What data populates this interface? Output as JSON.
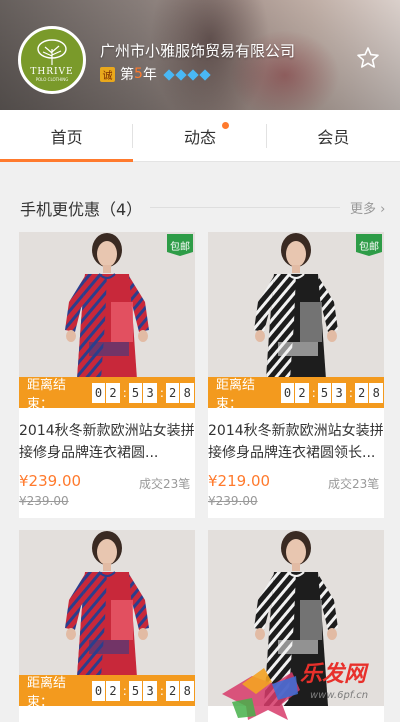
{
  "shop": {
    "logo_text": "THRIVE",
    "logo_sub": "POLO CLOTHING",
    "name": "广州市小雅服饰贸易有限公司",
    "cert_badge": "诚",
    "years_prefix": "第",
    "years_num": "5",
    "years_suffix": "年",
    "diamond_count": 4
  },
  "tabs": [
    {
      "label": "首页",
      "active": true
    },
    {
      "label": "动态",
      "active": false,
      "has_dot": true
    },
    {
      "label": "会员",
      "active": false
    }
  ],
  "section": {
    "title": "手机更优惠（4）",
    "more": "更多 ›"
  },
  "products": [
    {
      "free_ship": "包邮",
      "countdown_label": "距离结束：",
      "countdown": [
        "0",
        "2",
        "5",
        "3",
        "2",
        "8"
      ],
      "title": "2014秋冬新款欧洲站女装拼接修身品牌连衣裙圆...",
      "price": "¥239.00",
      "original_price": "¥239.00",
      "sold": "成交23笔",
      "style": "red"
    },
    {
      "free_ship": "包邮",
      "countdown_label": "距离结束：",
      "countdown": [
        "0",
        "2",
        "5",
        "3",
        "2",
        "8"
      ],
      "title": "2014秋冬新款欧洲站女装拼接修身品牌连衣裙圆领长...",
      "price": "¥219.00",
      "original_price": "¥239.00",
      "sold": "成交23笔",
      "style": "bw"
    },
    {
      "countdown_label": "距离结束：",
      "countdown": [
        "0",
        "2",
        "5",
        "3",
        "2",
        "8"
      ],
      "style": "red"
    },
    {
      "style": "bw"
    }
  ],
  "watermark": {
    "text": "乐发网",
    "url": "www.6pf.cn"
  },
  "colors": {
    "accent": "#ff7a2d",
    "countdown_bg": "#f39a1e",
    "free_ship_bg": "#2e9c47"
  }
}
